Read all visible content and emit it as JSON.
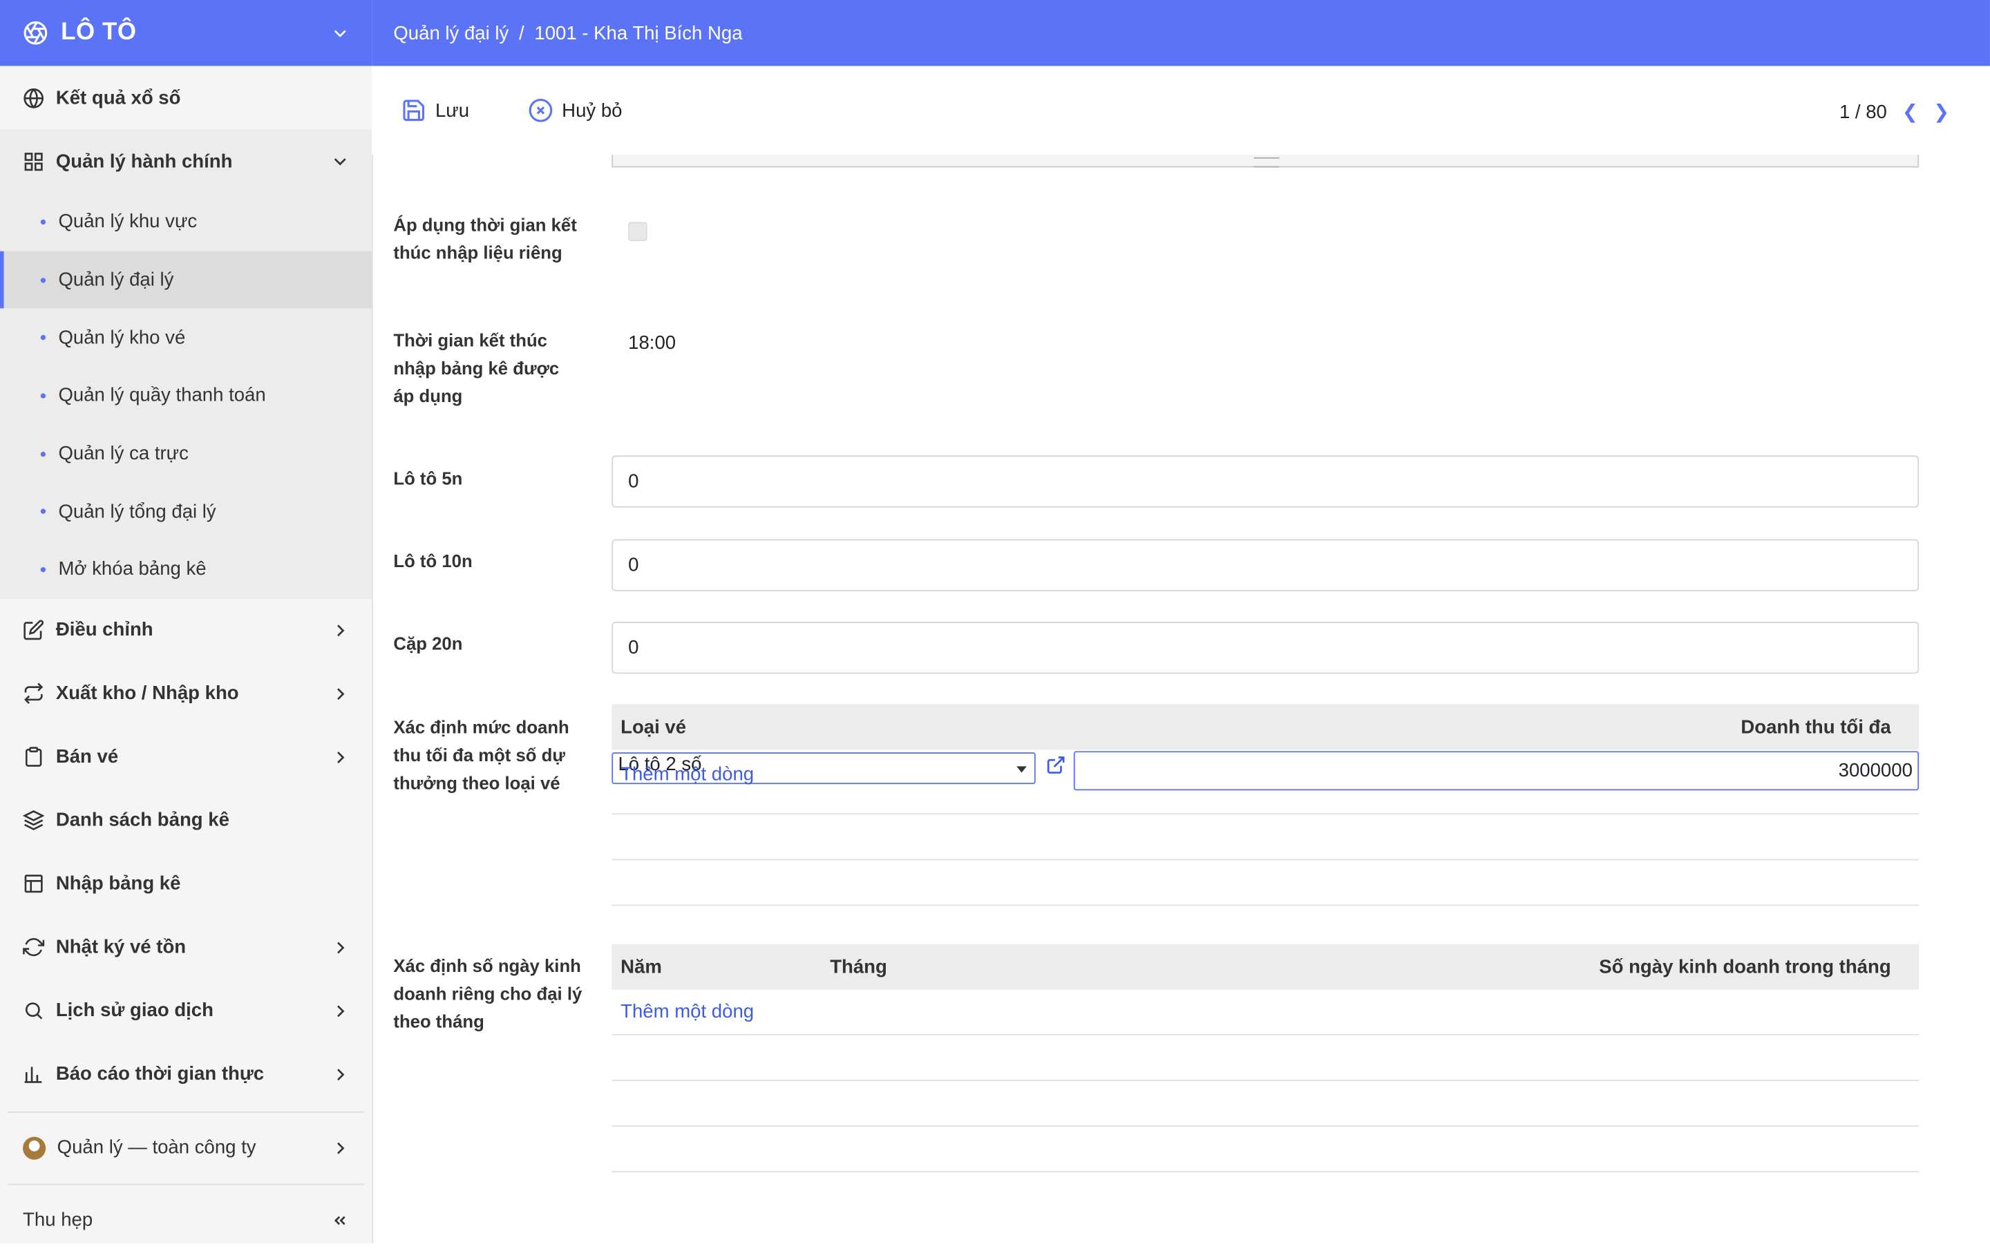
{
  "app": {
    "title": "LÔ TÔ"
  },
  "breadcrumb": {
    "parent": "Quản lý đại lý",
    "separator": "/",
    "current": "1001 - Kha Thị Bích Nga"
  },
  "toolbar": {
    "save_label": "Lưu",
    "cancel_label": "Huỷ bỏ",
    "pager": "1 / 80"
  },
  "sidebar": {
    "top_item": "Kết quả xổ số",
    "group": {
      "label": "Quản lý hành chính",
      "items": [
        "Quản lý khu vực",
        "Quản lý đại lý",
        "Quản lý kho vé",
        "Quản lý quầy thanh toán",
        "Quản lý ca trực",
        "Quản lý tổng đại lý",
        "Mở khóa bảng kê"
      ],
      "active_index": 1
    },
    "items": [
      {
        "label": "Điều chỉnh",
        "icon": "edit-icon",
        "arrow": true
      },
      {
        "label": "Xuất kho / Nhập kho",
        "icon": "transfer-icon",
        "arrow": true
      },
      {
        "label": "Bán vé",
        "icon": "clipboard-icon",
        "arrow": true
      },
      {
        "label": "Danh sách bảng kê",
        "icon": "layers-icon",
        "arrow": false
      },
      {
        "label": "Nhập bảng kê",
        "icon": "table-icon",
        "arrow": false
      },
      {
        "label": "Nhật ký vé tồn",
        "icon": "refresh-icon",
        "arrow": true
      },
      {
        "label": "Lịch sử giao dịch",
        "icon": "search-icon",
        "arrow": true
      },
      {
        "label": "Báo cáo thời gian thực",
        "icon": "bar-chart-icon",
        "arrow": true
      }
    ],
    "user": "Quản lý — toàn công ty",
    "collapse_label": "Thu hẹp"
  },
  "form": {
    "apply_end_time_label": "Áp dụng thời gian kết thúc nhập liệu riêng",
    "apply_end_time_checked": false,
    "end_time_label": "Thời gian kết thúc nhập bảng kê được áp dụng",
    "end_time_value": "18:00",
    "loto5_label": "Lô tô 5n",
    "loto5_value": "0",
    "loto10_label": "Lô tô 10n",
    "loto10_value": "0",
    "cap20_label": "Cặp 20n",
    "cap20_value": "0",
    "revenue_label": "Xác định mức doanh thu tối đa một số dự thưởng theo loại vé",
    "revenue_grid": {
      "col_type": "Loại vé",
      "col_max": "Doanh thu tối đa",
      "selected_type": "Lô tô 2 số",
      "max_value": "3000000",
      "add_line": "Thêm một dòng"
    },
    "days_label": "Xác định số ngày kinh doanh riêng cho đại lý theo tháng",
    "days_grid": {
      "col_year": "Năm",
      "col_month": "Tháng",
      "col_days": "Số ngày kinh doanh trong tháng",
      "add_line": "Thêm một dòng"
    }
  },
  "colors": {
    "primary": "#5b74f7",
    "link": "#3b5ce6"
  }
}
